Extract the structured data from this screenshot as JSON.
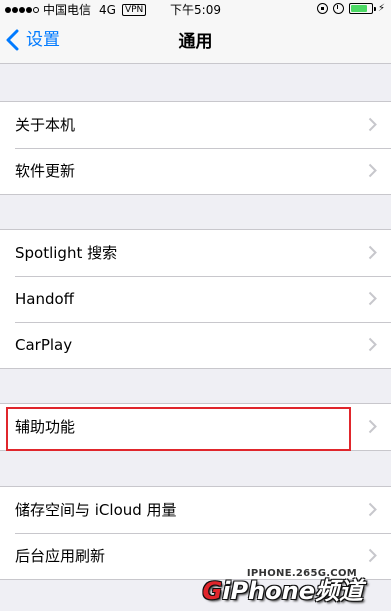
{
  "status_bar": {
    "carrier": "中国电信",
    "network": "4G",
    "vpn": "VPN",
    "time": "下午5:09"
  },
  "nav": {
    "back_label": "设置",
    "title": "通用"
  },
  "groups": [
    {
      "items": [
        {
          "label": "关于本机"
        },
        {
          "label": "软件更新"
        }
      ]
    },
    {
      "items": [
        {
          "label": "Spotlight 搜索"
        },
        {
          "label": "Handoff"
        },
        {
          "label": "CarPlay"
        }
      ]
    },
    {
      "items": [
        {
          "label": "辅助功能"
        }
      ]
    },
    {
      "items": [
        {
          "label": "储存空间与 iCloud 用量"
        },
        {
          "label": "后台应用刷新"
        }
      ]
    }
  ],
  "watermark": {
    "url": "IPHONE.265G.COM",
    "brand_g": "G",
    "brand_rest": "iPhone频道"
  },
  "colors": {
    "accent": "#007aff",
    "highlight": "#e0262c",
    "background": "#efeff4"
  }
}
